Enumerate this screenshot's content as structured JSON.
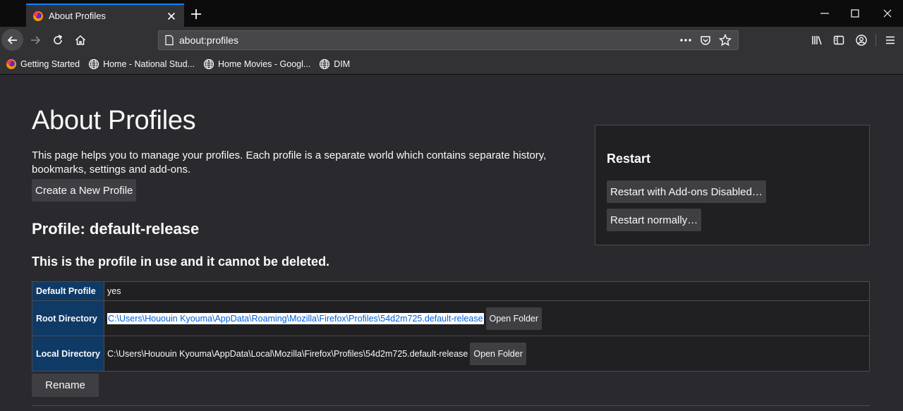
{
  "tab": {
    "title": "About Profiles"
  },
  "urlbar": {
    "url": "about:profiles"
  },
  "bookmarks": [
    {
      "label": "Getting Started",
      "icon": "firefox-icon"
    },
    {
      "label": "Home - National Stud...",
      "icon": "globe-icon"
    },
    {
      "label": "Home Movies - Googl...",
      "icon": "globe-icon"
    },
    {
      "label": "DIM",
      "icon": "globe-icon"
    }
  ],
  "page": {
    "title": "About Profiles",
    "description": "This page helps you to manage your profiles. Each profile is a separate world which contains separate history, bookmarks, settings and add-ons.",
    "create_button": "Create a New Profile",
    "profile_heading": "Profile: default-release",
    "in_use_notice": "This is the profile in use and it cannot be deleted."
  },
  "restart": {
    "title": "Restart",
    "addons_disabled_button": "Restart with Add-ons Disabled…",
    "normal_button": "Restart normally…"
  },
  "profile": {
    "rows": [
      {
        "label": "Default Profile",
        "value": "yes"
      },
      {
        "label": "Root Directory",
        "value": "C:\\Users\\Hououin Kyouma\\AppData\\Roaming\\Mozilla\\Firefox\\Profiles\\54d2m725.default-release",
        "button": "Open Folder"
      },
      {
        "label": "Local Directory",
        "value": "C:\\Users\\Hououin Kyouma\\AppData\\Local\\Mozilla\\Firefox\\Profiles\\54d2m725.default-release",
        "button": "Open Folder"
      }
    ],
    "rename_button": "Rename"
  },
  "colors": {
    "accent": "#0a84ff",
    "table_header": "#0f3a66",
    "background": "#2a2a2e"
  }
}
